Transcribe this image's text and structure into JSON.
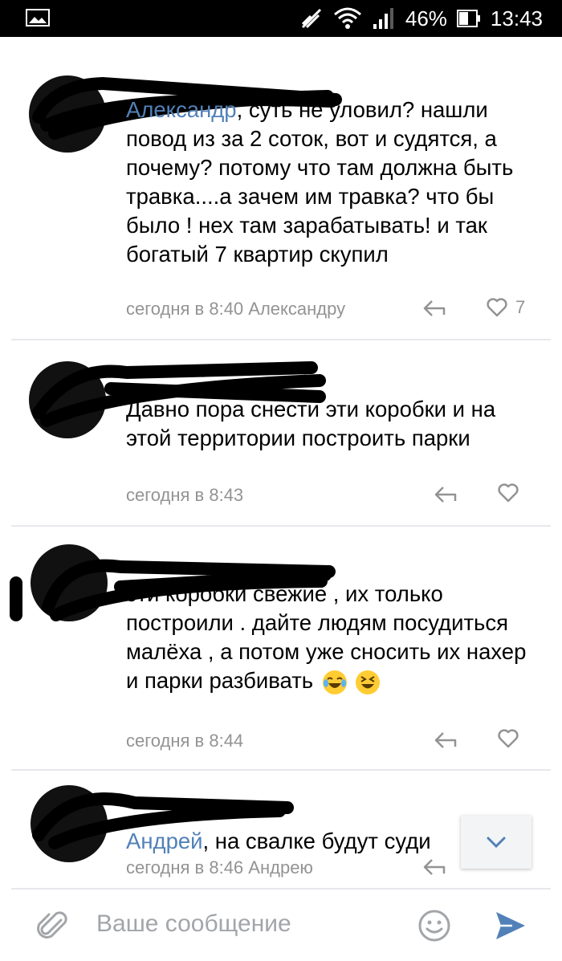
{
  "status_bar": {
    "battery_percent": "46%",
    "time": "13:43",
    "icons": [
      "gallery-icon",
      "no-data-icon",
      "wifi-icon",
      "signal-icon",
      "battery-icon"
    ]
  },
  "comments": [
    {
      "author": "",
      "mention": "Александр",
      "text": ", суть не уловил? нашли повод из за 2 соток, вот и судятся, а почему? потому что там должна быть травка....а зачем им травка? что бы было ! нех там зарабатывать! и так богатый 7 квартир скупил",
      "time": "сегодня в 8:40",
      "reply_to": "Александру",
      "likes": "7"
    },
    {
      "author": "",
      "mention": "",
      "text": "Давно пора снести эти коробки и на этой территории построить парки",
      "time": "сегодня в 8:43",
      "reply_to": "",
      "likes": ""
    },
    {
      "author": "",
      "mention": "",
      "text": "эти коробки свежие , их только построили . дайте людям посудиться малёха , а потом уже сносить их нахер и парки разбивать",
      "time": "сегодня в 8:44",
      "reply_to": "",
      "likes": ""
    },
    {
      "author": "",
      "mention": "Андрей",
      "text": ", на свалке будут суди",
      "time": "сегодня в 8:46",
      "reply_to": "Андрею",
      "likes": ""
    }
  ],
  "composer": {
    "placeholder": "Ваше сообщение"
  },
  "colors": {
    "link": "#5181b8",
    "meta": "#939393",
    "send": "#5181b8"
  }
}
